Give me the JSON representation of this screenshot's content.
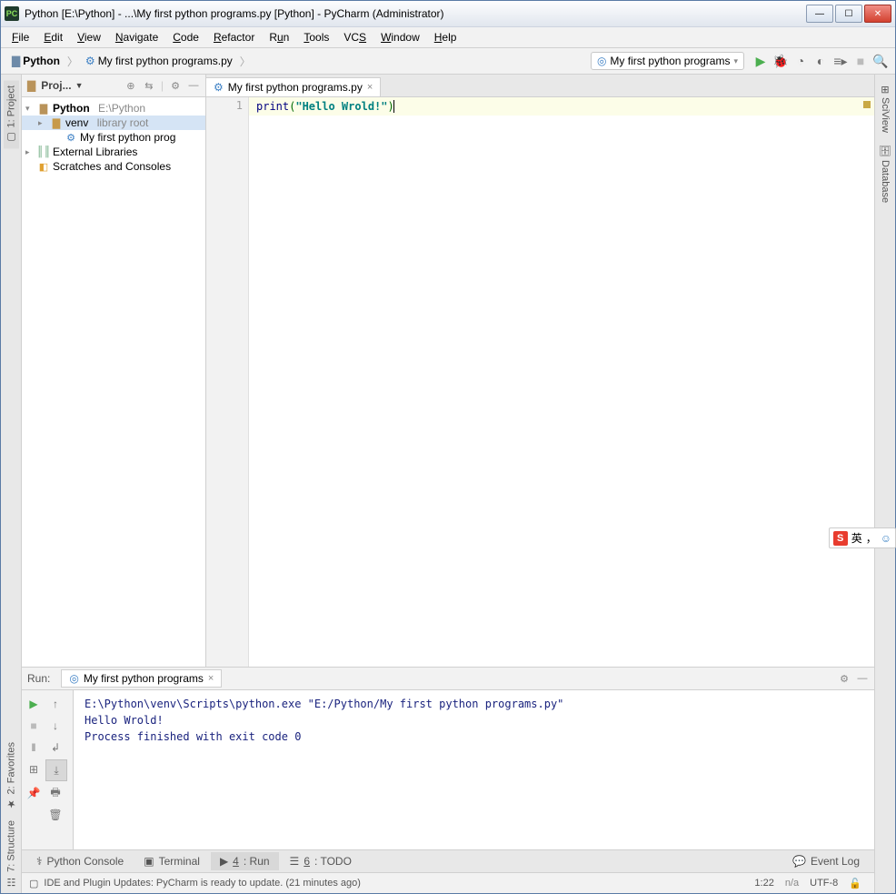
{
  "window": {
    "app_icon": "PC",
    "title": "Python [E:\\Python] - ...\\My first python programs.py [Python] - PyCharm (Administrator)"
  },
  "menubar": [
    "File",
    "Edit",
    "View",
    "Navigate",
    "Code",
    "Refactor",
    "Run",
    "Tools",
    "VCS",
    "Window",
    "Help"
  ],
  "breadcrumbs": {
    "root": "Python",
    "file": "My first python programs.py"
  },
  "run_config": {
    "label": "My first python programs"
  },
  "left_tabs": {
    "project": "1: Project"
  },
  "right_tabs": {
    "sciview": "SciView",
    "database": "Database"
  },
  "project_panel": {
    "title": "Proj..."
  },
  "tree": {
    "root": {
      "name": "Python",
      "path": "E:\\Python"
    },
    "venv": {
      "name": "venv",
      "suffix": "library root"
    },
    "file": "My first python prog",
    "ext_libs": "External Libraries",
    "scratches": "Scratches and Consoles"
  },
  "editor_tab": {
    "label": "My first python programs.py"
  },
  "code": {
    "line1": {
      "num": "1",
      "fn": "print",
      "open": "(",
      "str": "\"Hello Wrold!\"",
      "close": ")"
    }
  },
  "run_section": {
    "title": "Run:",
    "tab": "My first python programs"
  },
  "console": {
    "line1": "E:\\Python\\venv\\Scripts\\python.exe \"E:/Python/My first python programs.py\"",
    "line2": "Hello Wrold!",
    "line3": "",
    "line4": "Process finished with exit code 0"
  },
  "bottom_tabs": {
    "console": "Python Console",
    "terminal": "Terminal",
    "run": "4: Run",
    "todo": "6: TODO",
    "event_log": "Event Log"
  },
  "left_bottom_tabs": {
    "favorites": "2: Favorites",
    "structure": "7: Structure"
  },
  "statusbar": {
    "msg": "IDE and Plugin Updates: PyCharm is ready to update. (21 minutes ago)",
    "pos": "1:22",
    "na": "n/a",
    "enc": "UTF-8"
  },
  "ime": {
    "letter": "S",
    "label": "英",
    "punct": "，"
  }
}
